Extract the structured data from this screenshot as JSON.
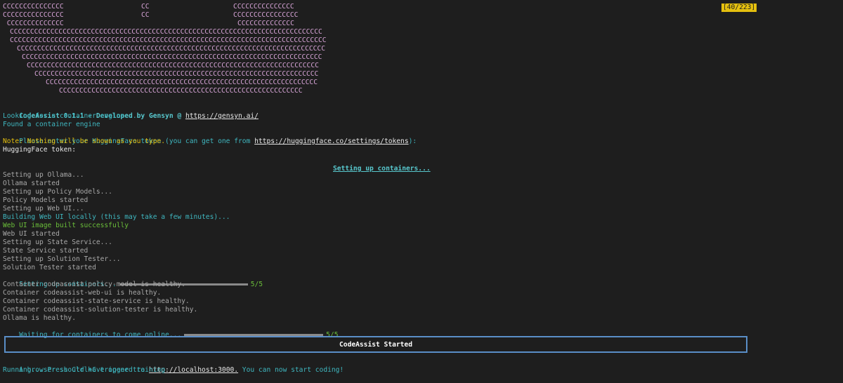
{
  "counter": "[40/223]",
  "art": {
    "row1_left": "CCCCCCCCCCCCCCC",
    "row1_mid": "CC",
    "row1_right": "CCCCCCCCCCCCCCC",
    "row2_left": "CCCCCCCCCCCCCCC",
    "row2_mid": "CC",
    "row2_right": "CCCCCCCCCCCCCCCC",
    "row3_left": " CCCCCCCCCCCCCC",
    "row3_right": "CCCCCCCCCCCCCC",
    "rows": [
      "CCCCCCCCCCCCCCCCCCCCCCCCCCCCCCCCCCCCCCCCCCCCCCCCCCCCCCCCCCCCCCCCCCCCCCCCCCCCC",
      "CCCCCCCCCCCCCCCCCCCCCCCCCCCCCCCCCCCCCCCCCCCCCCCCCCCCCCCCCCCCCCCCCCCCCCCCCCCCCC",
      "CCCCCCCCCCCCCCCCCCCCCCCCCCCCCCCCCCCCCCCCCCCCCCCCCCCCCCCCCCCCCCCCCCCCCCCCCCCC",
      "CCCCCCCCCCCCCCCCCCCCCCCCCCCCCCCCCCCCCCCCCCCCCCCCCCCCCCCCCCCCCCCCCCCCCCCCCC",
      "CCCCCCCCCCCCCCCCCCCCCCCCCCCCCCCCCCCCCCCCCCCCCCCCCCCCCCCCCCCCCCCCCCCCCCCC",
      "CCCCCCCCCCCCCCCCCCCCCCCCCCCCCCCCCCCCCCCCCCCCCCCCCCCCCCCCCCCCCCCCCCCCCC",
      "CCCCCCCCCCCCCCCCCCCCCCCCCCCCCCCCCCCCCCCCCCCCCCCCCCCCCCCCCCCCCCCCCCC",
      "CCCCCCCCCCCCCCCCCCCCCCCCCCCCCCCCCCCCCCCCCCCCCCCCCCCCCCCCCCCC"
    ]
  },
  "header": {
    "title": "CodeAssist 0.1.1 - Developed by Gensyn @ ",
    "url": "https://gensyn.ai/"
  },
  "lines": {
    "looking": "Looking for a container engine...",
    "found": "Found a container engine",
    "token_prompt": "Please enter your HuggingFace token (you can get one from ",
    "token_url": "https://huggingface.co/settings/tokens",
    "token_prompt_end": "):",
    "note": "Note: Nothing will be shown as you type.",
    "token_label": "HuggingFace token:",
    "setting_up_containers": "Setting up containers...",
    "ollama_setup": "Setting up Ollama...",
    "ollama_started": "Ollama started",
    "policy_setup": "Setting up Policy Models...",
    "policy_started": "Policy Models started",
    "webui_setup": "Setting up Web UI...",
    "webui_build": "Building Web UI locally (this may take a few minutes)...",
    "webui_built": "Web UI image built successfully",
    "webui_started": "Web UI started",
    "state_setup": "Setting up State Service...",
    "state_started": "State Service started",
    "tester_setup": "Setting up Solution Tester...",
    "tester_started": "Solution Tester started",
    "progress1_label": "Setting up containers...",
    "progress1_count": "5/5",
    "healthy1": "Container codeassist-policy-model is healthy.",
    "healthy2": "Container codeassist-web-ui is healthy.",
    "healthy3": "Container codeassist-state-service is healthy.",
    "healthy4": "Container codeassist-solution-tester is healthy.",
    "ollama_healthy": "Ollama is healthy.",
    "progress2_label": "Waiting for containers to come online...",
    "progress2_count": "5/5",
    "started_box": "CodeAssist Started",
    "browser_pre": "A browser should have opened to ",
    "browser_url": "http://localhost:3000.",
    "browser_post": " You can now start coding!",
    "running": "Running... Press Ctrl+C trigger training"
  }
}
